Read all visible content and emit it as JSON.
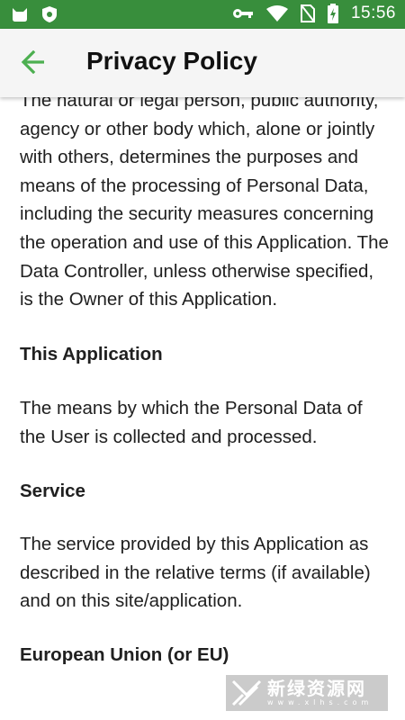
{
  "status_bar": {
    "time": "15:56",
    "background": "#388e3c",
    "left_icons": [
      "cat-icon",
      "shield-icon"
    ],
    "right_icons": [
      "key-icon",
      "wifi-icon",
      "no-sim-icon",
      "battery-charging-icon"
    ]
  },
  "app_bar": {
    "title": "Privacy Policy",
    "back_icon": "arrow-back-icon",
    "accent": "#4caf50"
  },
  "content": {
    "p1": "The natural or legal person, public authority, agency or other body which, alone or jointly with others, determines the purposes and means of the processing of Personal Data, including the security measures concerning the operation and use of this Application. The Data Controller, unless otherwise specified, is the Owner of this Application.",
    "h_app": "This Application",
    "p_app": "The means by which the Personal Data of the User is collected and processed.",
    "h_service": "Service",
    "p_service": "The service provided by this Application as described in the relative terms (if available) and on this site/application.",
    "h_eu": "European Union (or EU)"
  },
  "watermark": {
    "brand": "新绿资源网",
    "url": "www.xlhs.com"
  }
}
